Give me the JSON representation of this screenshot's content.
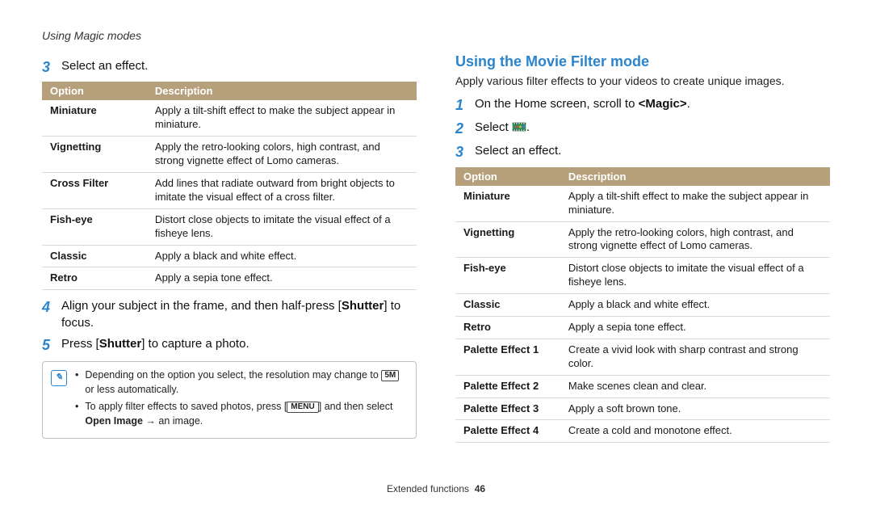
{
  "running_head": "Using Magic modes",
  "left": {
    "step3": {
      "num": "3",
      "text": "Select an effect."
    },
    "table": {
      "head_option": "Option",
      "head_desc": "Description",
      "rows": [
        {
          "name": "Miniature",
          "desc": "Apply a tilt-shift effect to make the subject appear in miniature."
        },
        {
          "name": "Vignetting",
          "desc": "Apply the retro-looking colors, high contrast, and strong vignette effect of Lomo cameras."
        },
        {
          "name": "Cross Filter",
          "desc": "Add lines that radiate outward from bright objects to imitate the visual effect of a cross filter."
        },
        {
          "name": "Fish-eye",
          "desc": "Distort close objects to imitate the visual effect of a fisheye lens."
        },
        {
          "name": "Classic",
          "desc": "Apply a black and white effect."
        },
        {
          "name": "Retro",
          "desc": "Apply a sepia tone effect."
        }
      ]
    },
    "step4": {
      "num": "4",
      "pre": "Align your subject in the frame, and then half-press [",
      "bold": "Shutter",
      "post": "] to focus."
    },
    "step5": {
      "num": "5",
      "pre": "Press [",
      "bold": "Shutter",
      "post": "] to capture a photo."
    },
    "note": {
      "line1_pre": "Depending on the option you select, the resolution may change to ",
      "line1_badge": "5M",
      "line1_post": " or less automatically.",
      "line2_pre": "To apply filter effects to saved photos, press [",
      "line2_badge": "MENU",
      "line2_mid": "] and then select ",
      "line2_bold": "Open Image",
      "line2_post": " → an image."
    }
  },
  "right": {
    "title": "Using the Movie Filter mode",
    "intro": "Apply various filter effects to your videos to create unique images.",
    "step1": {
      "num": "1",
      "pre": "On the Home screen, scroll to ",
      "bold": "<Magic>",
      "post": "."
    },
    "step2": {
      "num": "2",
      "text": "Select "
    },
    "step3": {
      "num": "3",
      "text": "Select an effect."
    },
    "table": {
      "head_option": "Option",
      "head_desc": "Description",
      "rows": [
        {
          "name": "Miniature",
          "desc": "Apply a tilt-shift effect to make the subject appear in miniature."
        },
        {
          "name": "Vignetting",
          "desc": "Apply the retro-looking colors, high contrast, and strong vignette effect of Lomo cameras."
        },
        {
          "name": "Fish-eye",
          "desc": "Distort close objects to imitate the visual effect of a fisheye lens."
        },
        {
          "name": "Classic",
          "desc": "Apply a black and white effect."
        },
        {
          "name": "Retro",
          "desc": "Apply a sepia tone effect."
        },
        {
          "name": "Palette Effect 1",
          "desc": "Create a vivid look with sharp contrast and strong color."
        },
        {
          "name": "Palette Effect 2",
          "desc": "Make scenes clean and clear."
        },
        {
          "name": "Palette Effect 3",
          "desc": "Apply a soft brown tone."
        },
        {
          "name": "Palette Effect 4",
          "desc": "Create a cold and monotone effect."
        }
      ]
    }
  },
  "footer": {
    "section": "Extended functions",
    "page": "46"
  }
}
